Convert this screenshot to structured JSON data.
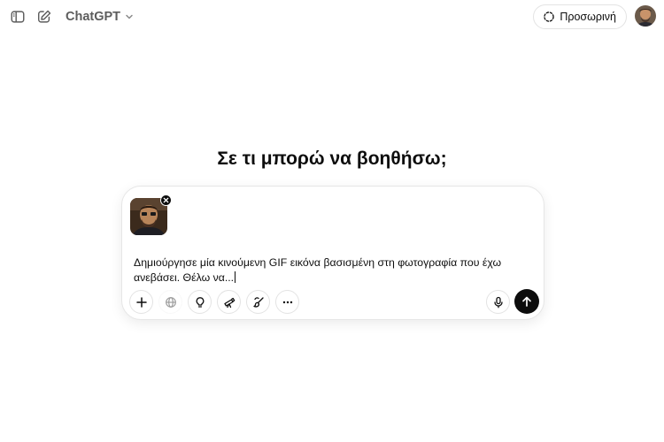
{
  "header": {
    "sidebar_toggle_icon": "sidebar-icon",
    "new_chat_icon": "compose-icon",
    "model_name": "ChatGPT",
    "temporary_chat_label": "Προσωρινή"
  },
  "main": {
    "headline": "Σε τι μπορώ να βοηθήσω;"
  },
  "composer": {
    "attachment_icon": "image-thumbnail",
    "prompt_text": "Δημιούργησε μία κινούμενη GIF εικόνα   βασισμένη στη φωτογραφία που έχω ανεβάσει. Θέλω να...",
    "tools": [
      "plus-icon",
      "globe-icon",
      "lightbulb-icon",
      "telescope-icon",
      "brush-icon",
      "more-icon"
    ]
  },
  "colors": {
    "text": "#0d0d0d",
    "muted": "#5d5d5d",
    "border": "#e3e3e3",
    "send_bg": "#0d0d0d"
  }
}
